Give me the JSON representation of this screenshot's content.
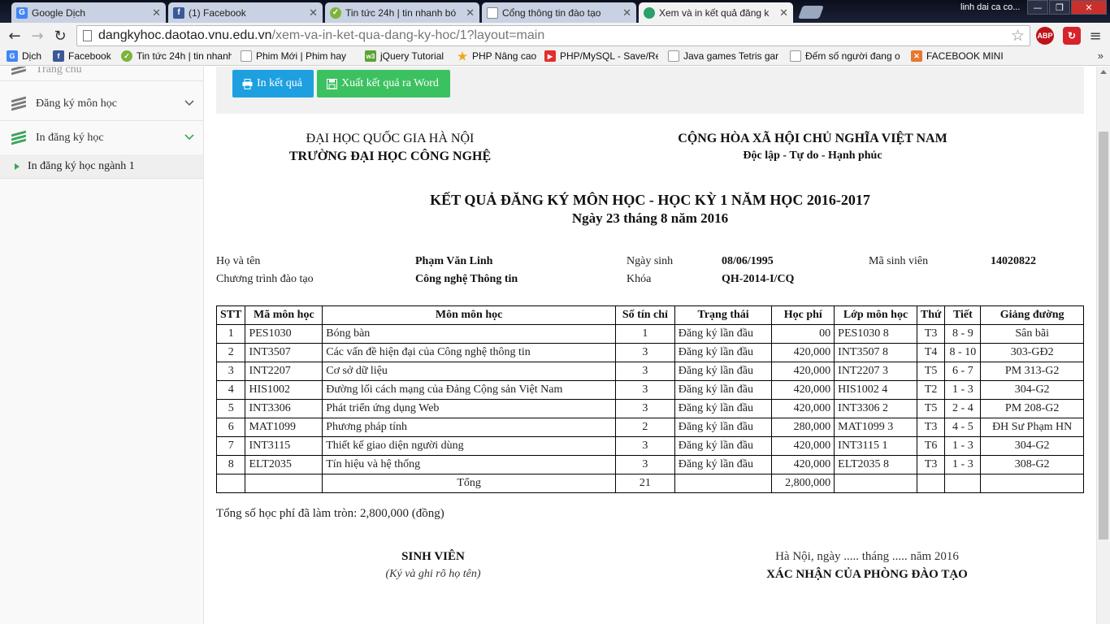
{
  "browser": {
    "tabs": [
      {
        "title": "Google Dịch",
        "icon": "google-translate-icon",
        "color": "#4285f4",
        "glyph": "G"
      },
      {
        "title": "(1) Facebook",
        "icon": "facebook-icon",
        "color": "#3b5998",
        "glyph": "f"
      },
      {
        "title": "Tin tức 24h | tin nhanh bó",
        "icon": "news-icon",
        "color": "#7db33a",
        "glyph": "✓"
      },
      {
        "title": "Cổng thông tin đào tạo",
        "icon": "page-icon",
        "color": "#ffffff",
        "glyph": ""
      },
      {
        "title": "Xem và in kết quả đăng k",
        "icon": "globe-icon",
        "color": "#2aa06c",
        "glyph": ""
      }
    ],
    "profile_name": "linh dai ca co...",
    "url_host": "dangkyhoc.daotao.vnu.edu.vn",
    "url_path": "/xem-va-in-ket-qua-dang-ky-hoc/1?layout=main",
    "extensions": {
      "abp": "ABP"
    },
    "bookmarks": [
      {
        "label": "Dịch",
        "icon": "google-translate-icon",
        "color": "#4285f4",
        "glyph": "G"
      },
      {
        "label": "Facebook",
        "icon": "facebook-icon",
        "color": "#3b5998",
        "glyph": "f"
      },
      {
        "label": "Tin tức 24h | tin nhanh",
        "icon": "news-icon",
        "color": "#7db33a",
        "glyph": "✓"
      },
      {
        "label": "Phim Mới | Phim hay",
        "icon": "film-icon",
        "color": "#ffffff",
        "glyph": ""
      },
      {
        "label": "jQuery Tutorial",
        "icon": "w3schools-icon",
        "color": "#5ba433",
        "glyph": "w3"
      },
      {
        "label": "PHP Nâng cao",
        "icon": "star-icon",
        "color": "#f2a61f",
        "glyph": "★"
      },
      {
        "label": "PHP/MySQL - Save/Re",
        "icon": "youtube-icon",
        "color": "#e52d27",
        "glyph": "▶"
      },
      {
        "label": "Java games Tetris gar",
        "icon": "page-icon",
        "color": "#ffffff",
        "glyph": ""
      },
      {
        "label": "Đếm số người đang o",
        "icon": "page-icon",
        "color": "#ffffff",
        "glyph": ""
      },
      {
        "label": "FACEBOOK MINI",
        "icon": "facebook-mini-icon",
        "color": "#e8772e",
        "glyph": "✕"
      }
    ],
    "bookmarks_more": "»"
  },
  "sidebar": {
    "home": "Trang chủ",
    "items": [
      {
        "label": "Đăng ký môn học"
      },
      {
        "label": "In đăng ký học"
      }
    ],
    "subitem": "In đăng ký học ngành 1"
  },
  "actions": {
    "print": "In kết quả",
    "export": "Xuất kết quả ra Word"
  },
  "header": {
    "university": "ĐẠI HỌC QUỐC GIA HÀ NỘI",
    "school": "TRƯỜNG ĐẠI HỌC CÔNG NGHỆ",
    "country": "CỘNG HÒA XÃ HỘI CHỦ NGHĨA VIỆT NAM",
    "motto": "Độc lập - Tự do - Hạnh phúc",
    "title": "KẾT QUẢ ĐĂNG KÝ MÔN HỌC - HỌC KỲ 1 NĂM HỌC 2016-2017",
    "date": "Ngày 23 tháng 8 năm 2016"
  },
  "student": {
    "name_label": "Họ và tên",
    "name": "Phạm Văn Linh",
    "dob_label": "Ngày sinh",
    "dob": "08/06/1995",
    "id_label": "Mã sinh viên",
    "id": "14020822",
    "program_label": "Chương trình đào tạo",
    "program": "Công nghệ Thông tin",
    "cohort_label": "Khóa",
    "cohort": "QH-2014-I/CQ"
  },
  "table": {
    "headers": [
      "STT",
      "Mã môn học",
      "Môn môn học",
      "Số tín chỉ",
      "Trạng thái",
      "Học phí",
      "Lớp môn học",
      "Thứ",
      "Tiết",
      "Giảng đường"
    ],
    "rows": [
      [
        "1",
        "PES1030",
        "Bóng bàn",
        "1",
        "Đăng ký lần đầu",
        "00",
        "PES1030 8",
        "T3",
        "8 - 9",
        "Sân bãi"
      ],
      [
        "2",
        "INT3507",
        "Các vấn đề hiện đại của Công nghệ thông tin",
        "3",
        "Đăng ký lần đầu",
        "420,000",
        "INT3507 8",
        "T4",
        "8 - 10",
        "303-GĐ2"
      ],
      [
        "3",
        "INT2207",
        "Cơ sở dữ liệu",
        "3",
        "Đăng ký lần đầu",
        "420,000",
        "INT2207 3",
        "T5",
        "6 - 7",
        "PM 313-G2"
      ],
      [
        "4",
        "HIS1002",
        "Đường lối cách mạng của Đảng Cộng sản Việt Nam",
        "3",
        "Đăng ký lần đầu",
        "420,000",
        "HIS1002 4",
        "T2",
        "1 - 3",
        "304-G2"
      ],
      [
        "5",
        "INT3306",
        "Phát triển ứng dụng Web",
        "3",
        "Đăng ký lần đầu",
        "420,000",
        "INT3306 2",
        "T5",
        "2 - 4",
        "PM 208-G2"
      ],
      [
        "6",
        "MAT1099",
        "Phương pháp tính",
        "2",
        "Đăng ký lần đầu",
        "280,000",
        "MAT1099 3",
        "T3",
        "4 - 5",
        "ĐH Sư Phạm HN"
      ],
      [
        "7",
        "INT3115",
        "Thiết kế giao diện người dùng",
        "3",
        "Đăng ký lần đầu",
        "420,000",
        "INT3115 1",
        "T6",
        "1 - 3",
        "304-G2"
      ],
      [
        "8",
        "ELT2035",
        "Tín hiệu và hệ thống",
        "3",
        "Đăng ký lần đầu",
        "420,000",
        "ELT2035 8",
        "T3",
        "1 - 3",
        "308-G2"
      ]
    ],
    "total_label": "Tổng",
    "total_credits": "21",
    "total_fee": "2,800,000"
  },
  "fee_note": "Tổng số học phí đã làm tròn: 2,800,000 (đồng)",
  "signatures": {
    "student": "SINH VIÊN",
    "student_note": "(Ký và ghi rõ họ tên)",
    "place_date": "Hà Nội, ngày ..... tháng ..... năm 2016",
    "office": "XÁC NHẬN CỦA PHÒNG ĐÀO TẠO"
  }
}
